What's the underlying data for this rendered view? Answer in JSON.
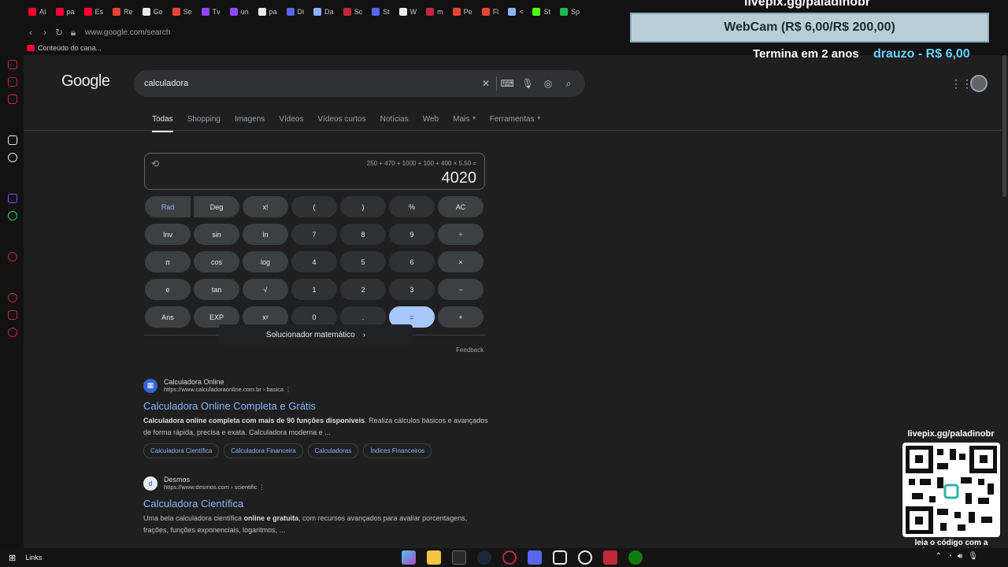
{
  "browser": {
    "tabs": [
      {
        "label": "AI",
        "color": "#ff0033"
      },
      {
        "label": "pa",
        "color": "#ff0033"
      },
      {
        "label": "Es",
        "color": "#ff0033"
      },
      {
        "label": "Re",
        "color": "#ea4335"
      },
      {
        "label": "Ge",
        "color": "#e8eaed"
      },
      {
        "label": "Se",
        "color": "#ea4335"
      },
      {
        "label": "Tv",
        "color": "#9146ff"
      },
      {
        "label": "un",
        "color": "#9146ff"
      },
      {
        "label": "pa",
        "color": "#e8eaed"
      },
      {
        "label": "Di",
        "color": "#5865f2"
      },
      {
        "label": "Da",
        "color": "#8ab4f8"
      },
      {
        "label": "Sc",
        "color": "#c0283b"
      },
      {
        "label": "St",
        "color": "#5865f2"
      },
      {
        "label": "W",
        "color": "#e8eaed"
      },
      {
        "label": "m",
        "color": "#c0283b"
      },
      {
        "label": "Pe",
        "color": "#ea4335"
      },
      {
        "label": "Fl",
        "color": "#ea4335"
      },
      {
        "label": "<",
        "color": "#8ab4f8"
      },
      {
        "label": "St",
        "color": "#53fc18"
      },
      {
        "label": "Sp",
        "color": "#1db954"
      }
    ],
    "url": "www.google.com/search",
    "bookmark": "Conteúdo do cana..."
  },
  "google": {
    "logo": "Google",
    "query": "calculadora",
    "tabs": [
      "Todas",
      "Shopping",
      "Imagens",
      "Vídeos",
      "Vídeos curtos",
      "Notícias",
      "Web",
      "Mais",
      "Ferramentas"
    ]
  },
  "calculator": {
    "expression": "250 + 470 + 1000 + 100 + 400 × 5.50 =",
    "result": "4020",
    "keys": [
      [
        "Rad",
        "Deg",
        "x!",
        "(",
        ")",
        "%",
        "AC"
      ],
      [
        "Inv",
        "sin",
        "ln",
        "7",
        "8",
        "9",
        "÷"
      ],
      [
        "π",
        "cos",
        "log",
        "4",
        "5",
        "6",
        "×"
      ],
      [
        "e",
        "tan",
        "√",
        "1",
        "2",
        "3",
        "−"
      ],
      [
        "Ans",
        "EXP",
        "xʸ",
        "0",
        ".",
        "=",
        "+"
      ]
    ],
    "solver": "Solucionador matemático",
    "feedback": "Feedback"
  },
  "results": [
    {
      "site": "Calculadora Online",
      "url": "https://www.calculadoraonline.com.br › basica",
      "title": "Calculadora Online Completa e Grátis",
      "snippet_bold": "Calculadora online completa com mais de 90 funções disponíveis",
      "snippet_rest": ". Realiza cálculos básicos e avançados de forma rápida, precisa e exata. Calculadora moderna e ...",
      "chips": [
        "Calculadora Científica",
        "Calculadora Financeira",
        "Calculadoras",
        "Índices Financeiros"
      ]
    },
    {
      "site": "Desmos",
      "url": "https://www.desmos.com › scientific",
      "title": "Calculadora Científica",
      "snippet_pre": "Uma bela calculadora científica ",
      "snippet_bold": "online e gratuita",
      "snippet_rest": ", com recursos avançados para avaliar porcentagens, frações, funções exponenciais, logaritmos, ..."
    }
  ],
  "overlay": {
    "livepix_top": "livepix.gg/paladinobr",
    "webcam_label": "WebCam",
    "webcam_price": "(R$ 6,00/R$ 200,00)",
    "termina": "Termina em 2 anos",
    "donor": "drauzo - R$ 6,00",
    "qr_label": "livepix.gg/paladinobr",
    "qr_caption": "leia o código com a câmera do celular."
  },
  "taskbar": {
    "links": "Links"
  }
}
